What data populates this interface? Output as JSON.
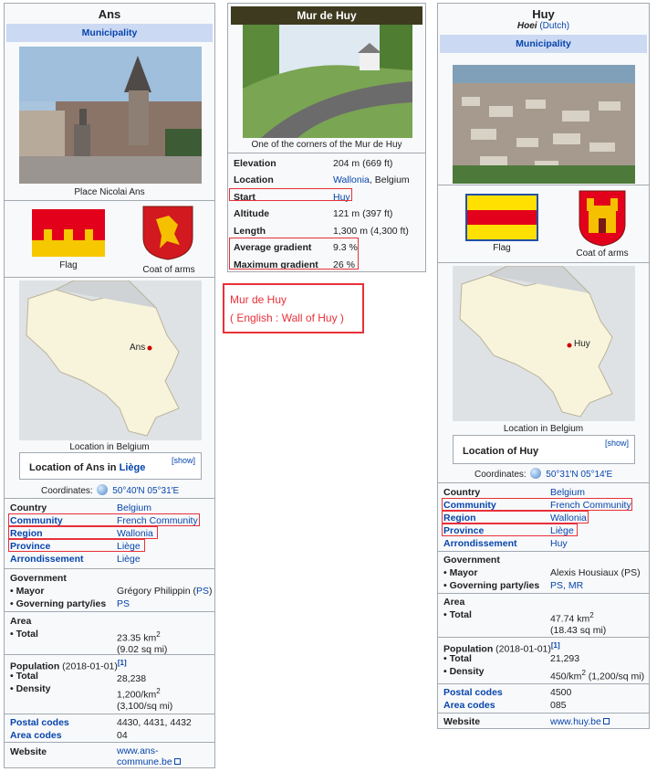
{
  "ans": {
    "title": "Ans",
    "band": "Municipality",
    "photo_caption": "Place Nicolai Ans",
    "flag_caption": "Flag",
    "coa_caption": "Coat of arms",
    "map_caption": "Location in Belgium",
    "map_label": "Ans",
    "nav_title": "Location of Ans in ",
    "nav_title_link": "Liège",
    "nav_show": "[show]",
    "coords_label": "Coordinates:",
    "coords_value": "50°40′N 05°31′E",
    "country_k": "Country",
    "country_v": "Belgium",
    "community_k": "Community",
    "community_v": "French Community",
    "region_k": "Region",
    "region_v": "Wallonia",
    "province_k": "Province",
    "province_v": "Liège",
    "arrond_k": "Arrondissement",
    "arrond_v": "Liège",
    "gov_head": "Government",
    "mayor_k": "• Mayor",
    "mayor_v": "Grégory Philippin",
    "mayor_party": "PS",
    "party_k": "• Governing party/ies",
    "party_v": "PS",
    "area_head": "Area",
    "area_total_k": "• Total",
    "area_total_v": "23.35 km",
    "area_total_v2": "(9.02 sq mi)",
    "pop_head": "Population",
    "pop_date": "(2018-01-01)",
    "pop_ref": "[1]",
    "pop_total_k": "• Total",
    "pop_total_v": "28,238",
    "pop_density_k": "• Density",
    "pop_density_v": "1,200/km",
    "pop_density_v2": "(3,100/sq mi)",
    "postal_k": "Postal codes",
    "postal_v": "4430, 4431, 4432",
    "areacode_k": "Area codes",
    "areacode_v": "04",
    "website_k": "Website",
    "website_v1": "www.ans-",
    "website_v2": "commune.be"
  },
  "mur": {
    "title": "Mur de Huy",
    "photo_caption": "One of the corners of the Mur de Huy",
    "elev_k": "Elevation",
    "elev_v": "204 m (669 ft)",
    "loc_k": "Location",
    "loc_v1": "Wallonia",
    "loc_v2": ", Belgium",
    "start_k": "Start",
    "start_v": "Huy",
    "alt_k": "Altitude",
    "alt_v": "121 m (397 ft)",
    "len_k": "Length",
    "len_v": "1,300 m (4,300 ft)",
    "avg_k": "Average gradient",
    "avg_v": "9.3 %",
    "max_k": "Maximum gradient",
    "max_v": "26 %"
  },
  "note": {
    "line1": "Mur de Huy",
    "line2": "( English : Wall of Huy )"
  },
  "huy": {
    "title": "Huy",
    "native": "Hoei",
    "native_lang": "(Dutch)",
    "band": "Municipality",
    "flag_caption": "Flag",
    "coa_caption": "Coat of arms",
    "map_caption": "Location in Belgium",
    "map_label": "Huy",
    "nav_title": "Location of Huy",
    "nav_show": "[show]",
    "coords_label": "Coordinates:",
    "coords_value": "50°31′N 05°14′E",
    "country_k": "Country",
    "country_v": "Belgium",
    "community_k": "Community",
    "community_v": "French Community",
    "region_k": "Region",
    "region_v": "Wallonia",
    "province_k": "Province",
    "province_v": "Liège",
    "arrond_k": "Arrondissement",
    "arrond_v": "Huy",
    "gov_head": "Government",
    "mayor_k": "• Mayor",
    "mayor_v": "Alexis Housiaux (PS)",
    "party_k": "• Governing party/ies",
    "party_v": "PS, MR",
    "area_head": "Area",
    "area_total_k": "• Total",
    "area_total_v": "47.74 km",
    "area_total_v2": "(18.43 sq mi)",
    "pop_head": "Population",
    "pop_date": "(2018-01-01)",
    "pop_ref": "[1]",
    "pop_total_k": "• Total",
    "pop_total_v": "21,293",
    "pop_density_k": "• Density",
    "pop_density_v": "450/km",
    "pop_density_v3": " (1,200/sq mi)",
    "postal_k": "Postal codes",
    "postal_v": "4500",
    "areacode_k": "Area codes",
    "areacode_v": "085",
    "website_k": "Website",
    "website_v": "www.huy.be"
  },
  "colors": {
    "link": "#0645ad",
    "band": "#ccd9f3",
    "highlight": "#e8313a",
    "mur_header": "#3d3a1f"
  }
}
